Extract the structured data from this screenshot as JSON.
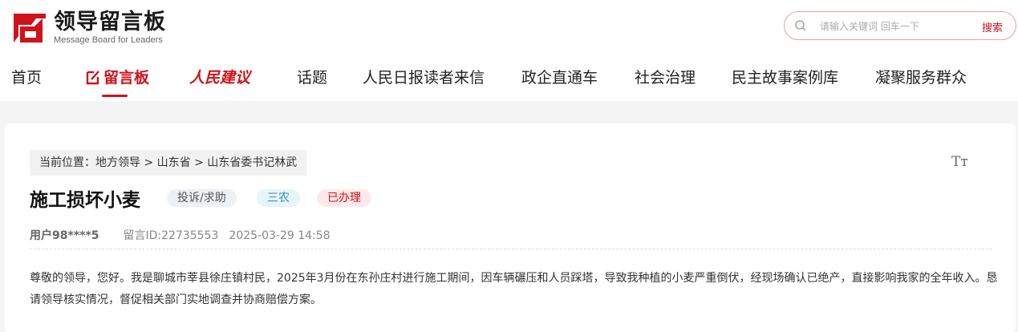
{
  "logo": {
    "title": "领导留言板",
    "subtitle": "Message Board for Leaders",
    "icon": "logo-mark",
    "brand_color": "#d0121b"
  },
  "search": {
    "placeholder": "请输入关键词 回车一下",
    "button": "搜索",
    "icon": "search-icon"
  },
  "nav": {
    "items": [
      "首页",
      "留言板",
      "人民建议",
      "话题",
      "人民日报读者来信",
      "政企直通车",
      "社会治理",
      "民主故事案例库",
      "凝聚服务群众"
    ],
    "active": "留言板",
    "active_icon": "edit-icon"
  },
  "breadcrumb": "当前位置：地方领导 > 山东省 > 山东省委书记林武",
  "font_toggle": "Tт",
  "post": {
    "title": "施工损坏小麦",
    "tags": [
      "投诉/求助",
      "三农",
      "已办理"
    ],
    "user": "用户98****5",
    "message_id": "留言ID:22735553",
    "datetime": "2025-03-29 14:58",
    "content": "尊敬的领导，您好。我是聊城市莘县徐庄镇村民，2025年3月份在东孙庄村进行施工期间，因车辆碾压和人员踩塔，导致我种植的小麦严重倒伏，经现场确认已绝产，直接影响我家的全年收入。恳请领导核实情况，督促相关部门实地调查并协商赔偿方案。"
  }
}
